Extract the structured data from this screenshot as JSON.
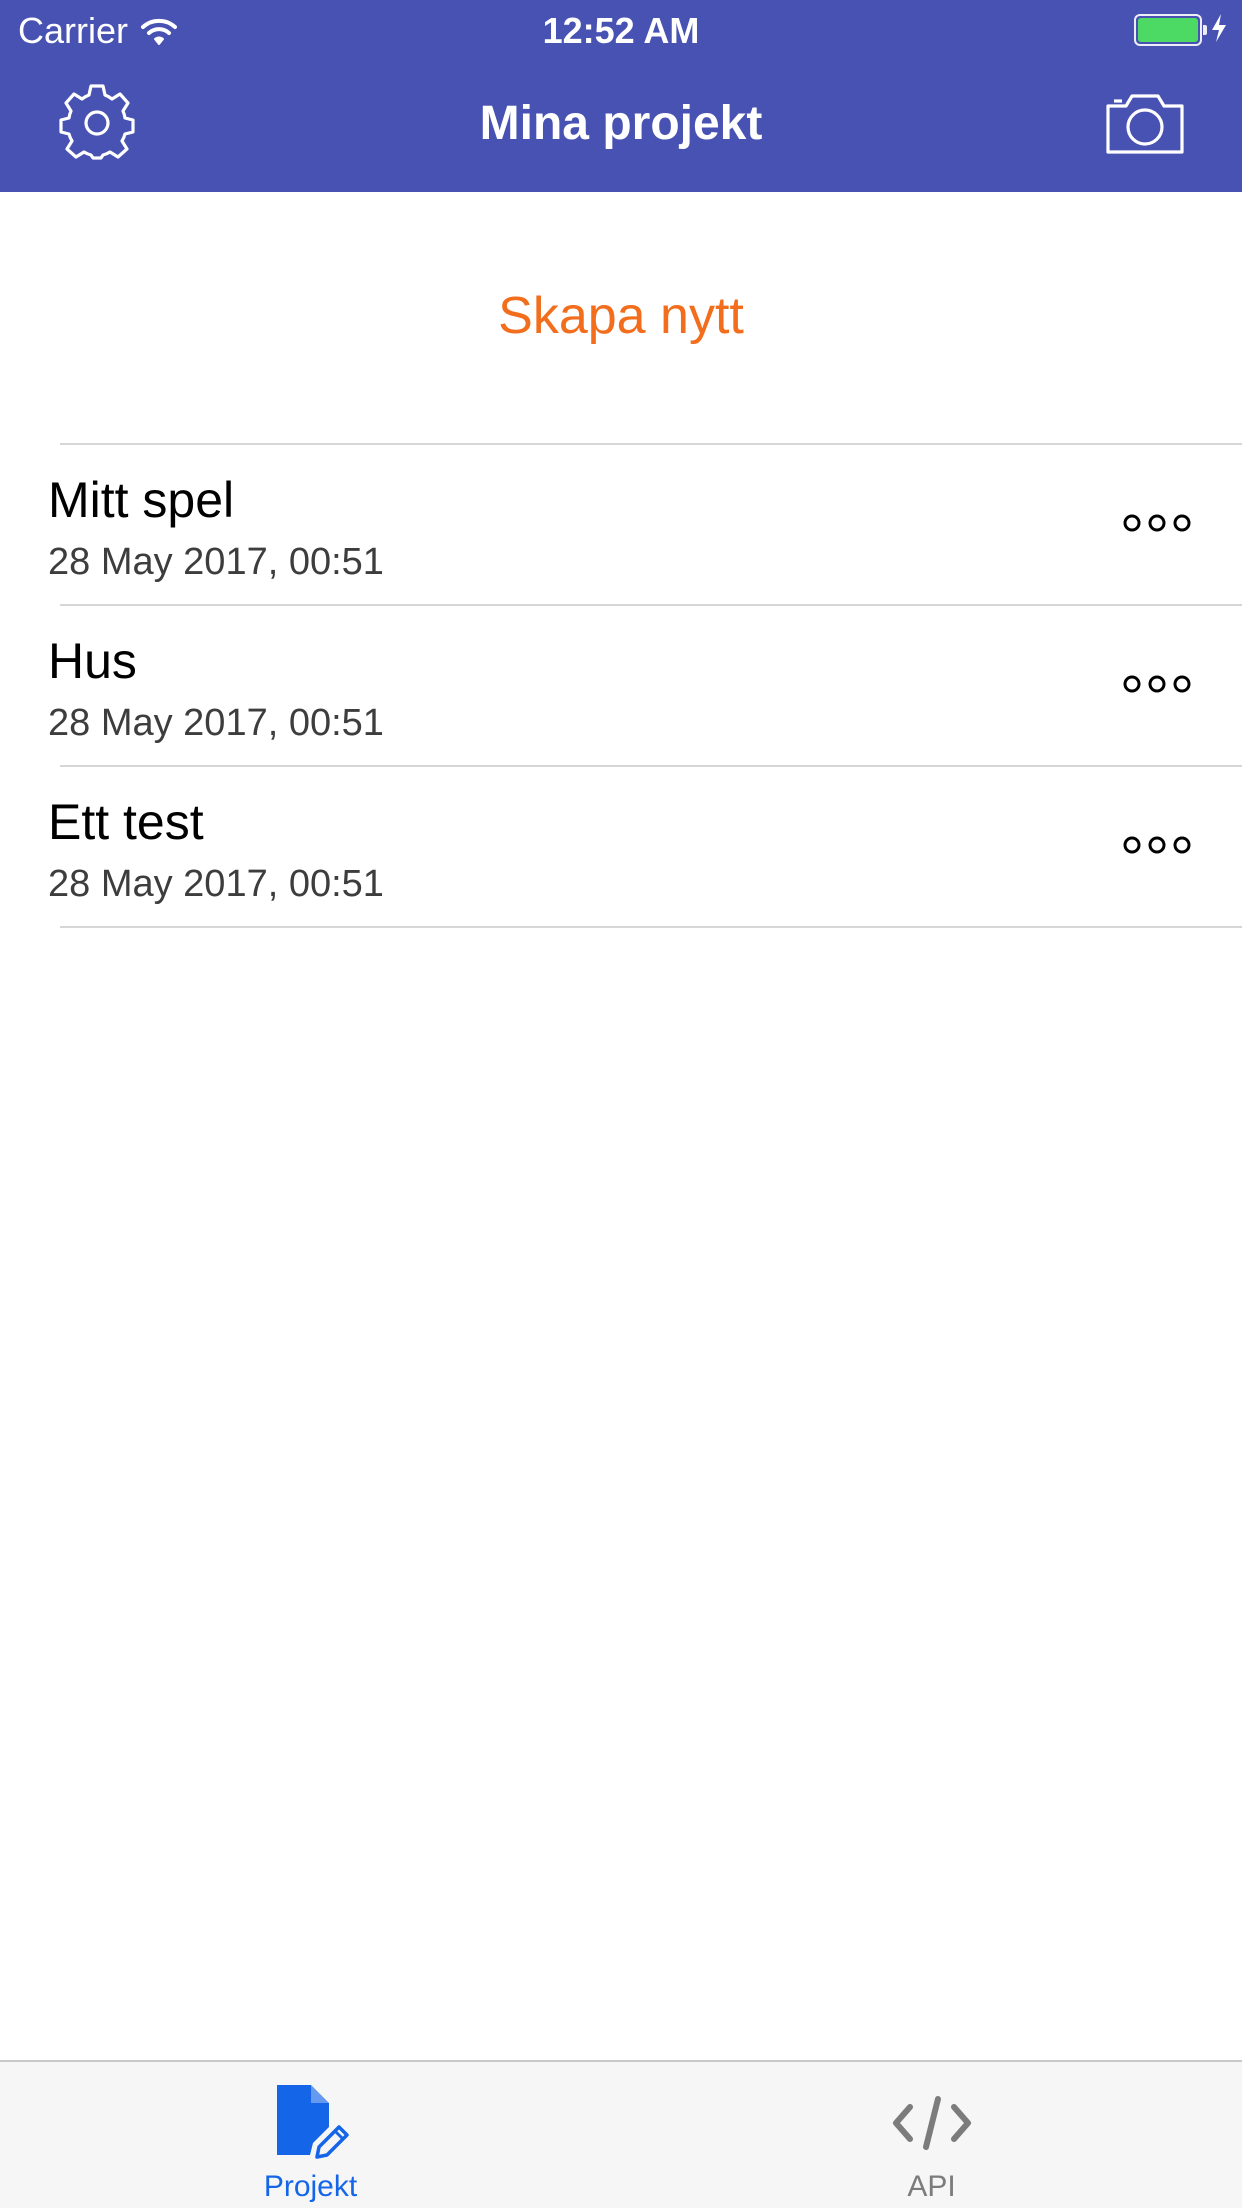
{
  "status_bar": {
    "carrier": "Carrier",
    "time": "12:52 AM",
    "battery_level": 1.0,
    "charging": true,
    "battery_color": "#4CD964"
  },
  "nav_bar": {
    "title": "Mina projekt",
    "background": "#4752B2",
    "left_icon": "gear-icon",
    "right_icon": "camera-icon"
  },
  "create_new": {
    "label": "Skapa nytt",
    "color": "#F26D1C"
  },
  "projects": [
    {
      "name": "Mitt spel",
      "date": "28 May 2017, 00:51",
      "more_icon": "more-icon"
    },
    {
      "name": "Hus",
      "date": "28 May 2017, 00:51",
      "more_icon": "more-icon"
    },
    {
      "name": "Ett test",
      "date": "28 May 2017, 00:51",
      "more_icon": "more-icon"
    }
  ],
  "tab_bar": {
    "tabs": [
      {
        "label": "Projekt",
        "icon": "document-edit-icon",
        "active": true,
        "color": "#1565E8"
      },
      {
        "label": "API",
        "icon": "code-icon",
        "active": false,
        "color": "#7c7c7c"
      }
    ]
  }
}
